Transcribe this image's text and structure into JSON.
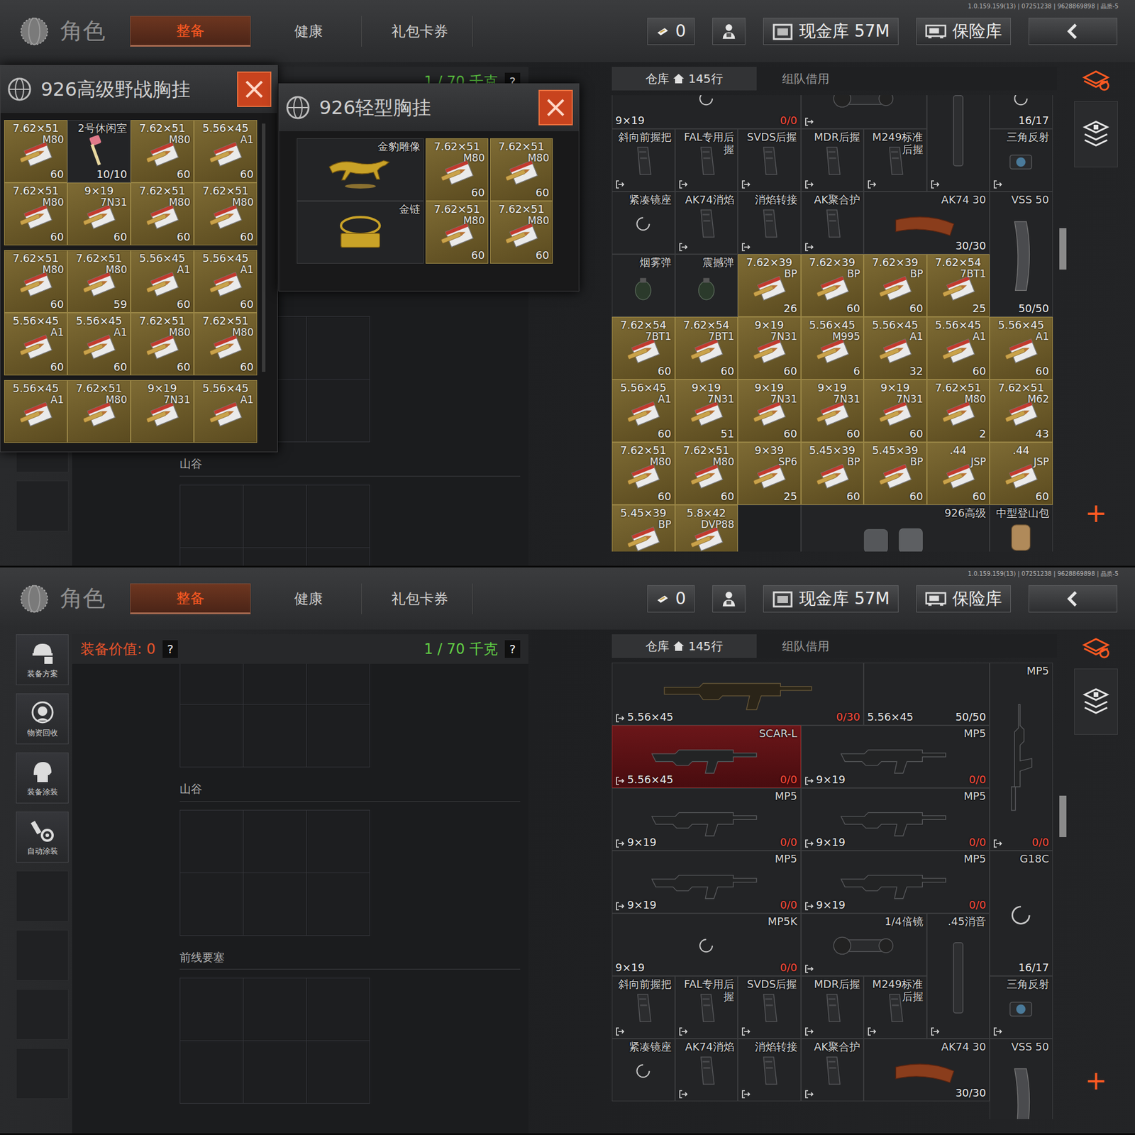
{
  "screens": [
    {
      "version": "1.0.159.159(13) | 07251238 | 9628869898 | 晶质-5",
      "logo": "角色",
      "tabs": [
        {
          "label": "整备",
          "selected": true
        },
        {
          "label": "健康",
          "selected": false
        },
        {
          "label": "礼包卡券",
          "selected": false
        }
      ],
      "ticket": "0",
      "cash": "现金库 57M",
      "safe": "保险库",
      "sidebar": [],
      "equipment": {
        "weight": "1 / 70 千克",
        "help": "?",
        "sections": [
          {},
          {
            "title": "山谷"
          }
        ]
      },
      "warehouse": {
        "tabs": [
          {
            "label": "仓库",
            "count": "145行",
            "selected": true
          },
          {
            "label": "组队借用",
            "selected": false
          }
        ],
        "add": "+",
        "items": [
          {
            "kind": "gun3-wait",
            "cal": "9×19",
            "count": "0/0",
            "empty": true,
            "selected": false
          },
          {
            "kind": "scope2",
            "empty": false,
            "selected": false
          },
          {
            "kind": "sil2",
            "empty": false,
            "selected": false
          },
          {
            "kind": "part-wait",
            "count": "16/17",
            "empty": false,
            "selected": false
          },
          {
            "kind": "part",
            "name": "斜向前握把",
            "empty": false,
            "selected": false
          },
          {
            "kind": "part",
            "name": "FAL专用后握",
            "empty": false,
            "selected": false
          },
          {
            "kind": "part",
            "name": "SVDS后握",
            "empty": false,
            "selected": false
          },
          {
            "kind": "part",
            "name": "MDR后握",
            "empty": false,
            "selected": false
          },
          {
            "kind": "part",
            "name": "M249标准后握",
            "empty": false,
            "selected": false
          },
          {
            "kind": "scope1",
            "name": "三角反射",
            "empty": false,
            "selected": false
          },
          {
            "kind": "part-wait",
            "name": "紧凑镜座",
            "empty": false,
            "selected": false
          },
          {
            "kind": "part",
            "name": "AK74消焰",
            "empty": false,
            "selected": false
          },
          {
            "kind": "part",
            "name": "消焰转接",
            "empty": false,
            "selected": false
          },
          {
            "kind": "part",
            "name": "AK聚合护",
            "empty": false,
            "selected": false
          },
          {
            "kind": "mag2",
            "name": "AK74 30",
            "count": "30/30",
            "empty": false,
            "selected": false
          },
          {
            "kind": "magv2",
            "name": "VSS 50",
            "count": "50/50",
            "empty": false,
            "selected": false
          },
          {
            "kind": "nade",
            "name": "烟雾弹",
            "empty": false,
            "selected": false
          },
          {
            "kind": "nade",
            "name": "震撼弹",
            "empty": false,
            "selected": false
          },
          {
            "kind": "ammo",
            "cal": "7.62×39",
            "type": "BP",
            "count": "26",
            "empty": false,
            "selected": false
          },
          {
            "kind": "ammo",
            "cal": "7.62×39",
            "type": "BP",
            "count": "60",
            "empty": false,
            "selected": false
          },
          {
            "kind": "ammo",
            "cal": "7.62×39",
            "type": "BP",
            "count": "60",
            "empty": false,
            "selected": false
          },
          {
            "kind": "ammo",
            "cal": "7.62×54",
            "type": "7BT1",
            "count": "25",
            "empty": false,
            "selected": false
          },
          {
            "kind": "ammo",
            "cal": "7.62×54",
            "type": "7BT1",
            "count": "60",
            "empty": false,
            "selected": false
          },
          {
            "kind": "ammo",
            "cal": "7.62×54",
            "type": "7BT1",
            "count": "60",
            "empty": false,
            "selected": false
          },
          {
            "kind": "ammo",
            "cal": "9×19",
            "type": "7N31",
            "count": "60",
            "empty": false,
            "selected": false
          },
          {
            "kind": "ammo",
            "cal": "5.56×45",
            "type": "M995",
            "count": "6",
            "empty": false,
            "selected": false
          },
          {
            "kind": "ammo",
            "cal": "5.56×45",
            "type": "A1",
            "count": "32",
            "empty": false,
            "selected": false
          },
          {
            "kind": "ammo",
            "cal": "5.56×45",
            "type": "A1",
            "count": "60",
            "empty": false,
            "selected": false
          },
          {
            "kind": "ammo",
            "cal": "5.56×45",
            "type": "A1",
            "count": "60",
            "empty": false,
            "selected": false
          },
          {
            "kind": "ammo",
            "cal": "5.56×45",
            "type": "A1",
            "count": "60",
            "empty": false,
            "selected": false
          },
          {
            "kind": "ammo",
            "cal": "9×19",
            "type": "7N31",
            "count": "51",
            "empty": false,
            "selected": false
          },
          {
            "kind": "ammo",
            "cal": "9×19",
            "type": "7N31",
            "count": "60",
            "empty": false,
            "selected": false
          },
          {
            "kind": "ammo",
            "cal": "9×19",
            "type": "7N31",
            "count": "60",
            "empty": false,
            "selected": false
          },
          {
            "kind": "ammo",
            "cal": "9×19",
            "type": "7N31",
            "count": "60",
            "empty": false,
            "selected": false
          },
          {
            "kind": "ammo",
            "cal": "7.62×51",
            "type": "M80",
            "count": "2",
            "empty": false,
            "selected": false
          },
          {
            "kind": "ammo",
            "cal": "7.62×51",
            "type": "M62",
            "count": "43",
            "empty": false,
            "selected": false
          },
          {
            "kind": "ammo",
            "cal": "7.62×51",
            "type": "M80",
            "count": "60",
            "empty": false,
            "selected": false
          },
          {
            "kind": "ammo",
            "cal": "7.62×51",
            "type": "M80",
            "count": "60",
            "empty": false,
            "selected": false
          },
          {
            "kind": "ammo",
            "cal": "9×39",
            "type": "SP6",
            "count": "25",
            "empty": false,
            "selected": false
          },
          {
            "kind": "ammo",
            "cal": "5.45×39",
            "type": "BP",
            "count": "60",
            "empty": false,
            "selected": false
          },
          {
            "kind": "ammo",
            "cal": "5.45×39",
            "type": "BP",
            "count": "60",
            "empty": false,
            "selected": false
          },
          {
            "kind": "ammo",
            "cal": ".44",
            "type": "JSP",
            "count": "60",
            "empty": false,
            "selected": false
          },
          {
            "kind": "ammo",
            "cal": ".44",
            "type": "JSP",
            "count": "60",
            "empty": false,
            "selected": false
          },
          {
            "kind": "ammo",
            "cal": "5.45×39",
            "type": "BP",
            "empty": false,
            "selected": false
          },
          {
            "kind": "ammo",
            "cal": "5.8×42",
            "type": "DVP88",
            "empty": false,
            "selected": false
          },
          {
            "kind": "empty",
            "empty": true,
            "selected": false
          },
          {
            "kind": "pack3",
            "name": "926高级",
            "empty": false,
            "selected": false
          },
          {
            "kind": "bag",
            "name": "中型登山包",
            "empty": false,
            "selected": false
          }
        ]
      },
      "popups": [
        {
          "title": "926高级野战胸挂",
          "items": [
            {
              "kind": "ammo",
              "cal": "7.62×51",
              "type": "M80",
              "count": "60",
              "empty": false,
              "selected": false
            },
            {
              "kind": "key",
              "name": "2号休闲室",
              "count": "10/10",
              "empty": false,
              "selected": false
            },
            {
              "kind": "ammo",
              "cal": "7.62×51",
              "type": "M80",
              "count": "60",
              "empty": false,
              "selected": false
            },
            {
              "kind": "ammo",
              "cal": "5.56×45",
              "type": "A1",
              "count": "60",
              "empty": false,
              "selected": false
            },
            {
              "kind": "ammo",
              "cal": "7.62×51",
              "type": "M80",
              "count": "60",
              "empty": false,
              "selected": false
            },
            {
              "kind": "ammo",
              "cal": "9×19",
              "type": "7N31",
              "count": "60",
              "empty": false,
              "selected": false
            },
            {
              "kind": "ammo",
              "cal": "7.62×51",
              "type": "M80",
              "count": "60",
              "empty": false,
              "selected": false
            },
            {
              "kind": "ammo",
              "cal": "7.62×51",
              "type": "M80",
              "count": "60",
              "empty": false,
              "selected": false
            },
            {
              "kind": "ammo",
              "cal": "7.62×51",
              "type": "M80",
              "count": "60",
              "empty": false,
              "selected": false
            },
            {
              "kind": "ammo",
              "cal": "7.62×51",
              "type": "M80",
              "count": "59",
              "empty": false,
              "selected": false
            },
            {
              "kind": "ammo",
              "cal": "5.56×45",
              "type": "A1",
              "count": "60",
              "empty": false,
              "selected": false
            },
            {
              "kind": "ammo",
              "cal": "5.56×45",
              "type": "A1",
              "count": "60",
              "empty": false,
              "selected": false
            },
            {
              "kind": "ammo",
              "cal": "5.56×45",
              "type": "A1",
              "count": "60",
              "empty": false,
              "selected": false
            },
            {
              "kind": "ammo",
              "cal": "5.56×45",
              "type": "A1",
              "count": "60",
              "empty": false,
              "selected": false
            },
            {
              "kind": "ammo",
              "cal": "7.62×51",
              "type": "M80",
              "count": "60",
              "empty": false,
              "selected": false
            },
            {
              "kind": "ammo",
              "cal": "7.62×51",
              "type": "M80",
              "count": "60",
              "empty": false,
              "selected": false
            },
            {
              "kind": "ammo",
              "cal": "5.56×45",
              "type": "A1",
              "empty": false,
              "selected": false
            },
            {
              "kind": "ammo",
              "cal": "7.62×51",
              "type": "M80",
              "empty": false,
              "selected": false
            },
            {
              "kind": "ammo",
              "cal": "9×19",
              "type": "7N31",
              "empty": false,
              "selected": false
            },
            {
              "kind": "ammo",
              "cal": "5.56×45",
              "type": "A1",
              "empty": false,
              "selected": false
            }
          ]
        },
        {
          "title": "926轻型胸挂",
          "items": [
            {
              "kind": "statue",
              "name": "金豹雕像",
              "empty": false,
              "selected": false
            },
            {
              "kind": "ammo",
              "cal": "7.62×51",
              "type": "M80",
              "count": "60",
              "empty": false,
              "selected": false
            },
            {
              "kind": "ammo",
              "cal": "7.62×51",
              "type": "M80",
              "count": "60",
              "empty": false,
              "selected": false
            },
            {
              "kind": "chain",
              "name": "金链",
              "empty": false,
              "selected": false
            },
            {
              "kind": "ammo",
              "cal": "7.62×51",
              "type": "M80",
              "count": "60",
              "empty": false,
              "selected": false
            },
            {
              "kind": "ammo",
              "cal": "7.62×51",
              "type": "M80",
              "count": "60",
              "empty": false,
              "selected": false
            }
          ]
        }
      ]
    },
    {
      "version": "1.0.159.159(13) | 07251238 | 9628869898 | 晶质-5",
      "logo": "角色",
      "tabs": [
        {
          "label": "整备",
          "selected": true
        },
        {
          "label": "健康",
          "selected": false
        },
        {
          "label": "礼包卡券",
          "selected": false
        }
      ],
      "ticket": "0",
      "cash": "现金库 57M",
      "safe": "保险库",
      "sidebar": [
        {
          "label": "装备方案"
        },
        {
          "label": "物资回收"
        },
        {
          "label": "装备涂装"
        },
        {
          "label": "自动涂装"
        }
      ],
      "equipment": {
        "value": "装备价值: 0",
        "value_help": "?",
        "weight": "1 / 70 千克",
        "help": "?",
        "sections": [
          {},
          {
            "title": "山谷"
          },
          {
            "title": "前线要塞"
          }
        ]
      },
      "warehouse": {
        "tabs": [
          {
            "label": "仓库",
            "count": "145行",
            "selected": true
          },
          {
            "label": "组队借用",
            "selected": false
          }
        ],
        "add": "+",
        "items": [
          {
            "kind": "gun4",
            "cal": "5.56×45",
            "count": "0/30",
            "empty": true,
            "selected": false
          },
          {
            "kind": "plain2",
            "cal": "5.56×45",
            "count": "50/50",
            "empty": false,
            "selected": false
          },
          {
            "kind": "gunv3",
            "name": "MP5",
            "count": "0/0",
            "empty": true,
            "selected": false
          },
          {
            "kind": "gun3",
            "name": "SCAR-L",
            "cal": "5.56×45",
            "count": "0/0",
            "empty": true,
            "selected": true
          },
          {
            "kind": "gun3",
            "name": "MP5",
            "cal": "9×19",
            "count": "0/0",
            "empty": true,
            "selected": false
          },
          {
            "kind": "gun3",
            "name": "MP5",
            "cal": "9×19",
            "count": "0/0",
            "empty": true,
            "selected": false
          },
          {
            "kind": "gun3",
            "name": "MP5",
            "cal": "9×19",
            "count": "0/0",
            "empty": true,
            "selected": false
          },
          {
            "kind": "gun3",
            "name": "MP5",
            "cal": "9×19",
            "count": "0/0",
            "empty": true,
            "selected": false
          },
          {
            "kind": "gun3",
            "name": "MP5",
            "cal": "9×19",
            "count": "0/0",
            "empty": true,
            "selected": false
          },
          {
            "kind": "pistol2-wait",
            "name": "G18C",
            "count": "16/17",
            "empty": false,
            "selected": false
          },
          {
            "kind": "gun3-wait",
            "name": "MP5K",
            "cal": "9×19",
            "count": "0/0",
            "empty": true,
            "selected": false
          },
          {
            "kind": "scope2",
            "name": "1/4倍镜",
            "empty": false,
            "selected": false
          },
          {
            "kind": "sil2",
            "name": ".45消音",
            "empty": false,
            "selected": false
          },
          {
            "kind": "part",
            "name": "斜向前握把",
            "empty": false,
            "selected": false
          },
          {
            "kind": "part",
            "name": "FAL专用后握",
            "empty": false,
            "selected": false
          },
          {
            "kind": "part",
            "name": "SVDS后握",
            "empty": false,
            "selected": false
          },
          {
            "kind": "part",
            "name": "MDR后握",
            "empty": false,
            "selected": false
          },
          {
            "kind": "part",
            "name": "M249标准后握",
            "empty": false,
            "selected": false
          },
          {
            "kind": "scope1",
            "name": "三角反射",
            "empty": false,
            "selected": false
          },
          {
            "kind": "part-wait",
            "name": "紧凑镜座",
            "empty": false,
            "selected": false
          },
          {
            "kind": "part",
            "name": "AK74消焰",
            "empty": false,
            "selected": false
          },
          {
            "kind": "part",
            "name": "消焰转接",
            "empty": false,
            "selected": false
          },
          {
            "kind": "part",
            "name": "AK聚合护",
            "empty": false,
            "selected": false
          },
          {
            "kind": "mag2",
            "name": "AK74 30",
            "count": "30/30",
            "empty": false,
            "selected": false
          },
          {
            "kind": "magv2",
            "name": "VSS 50",
            "empty": false,
            "selected": false
          }
        ]
      },
      "popups": []
    }
  ]
}
